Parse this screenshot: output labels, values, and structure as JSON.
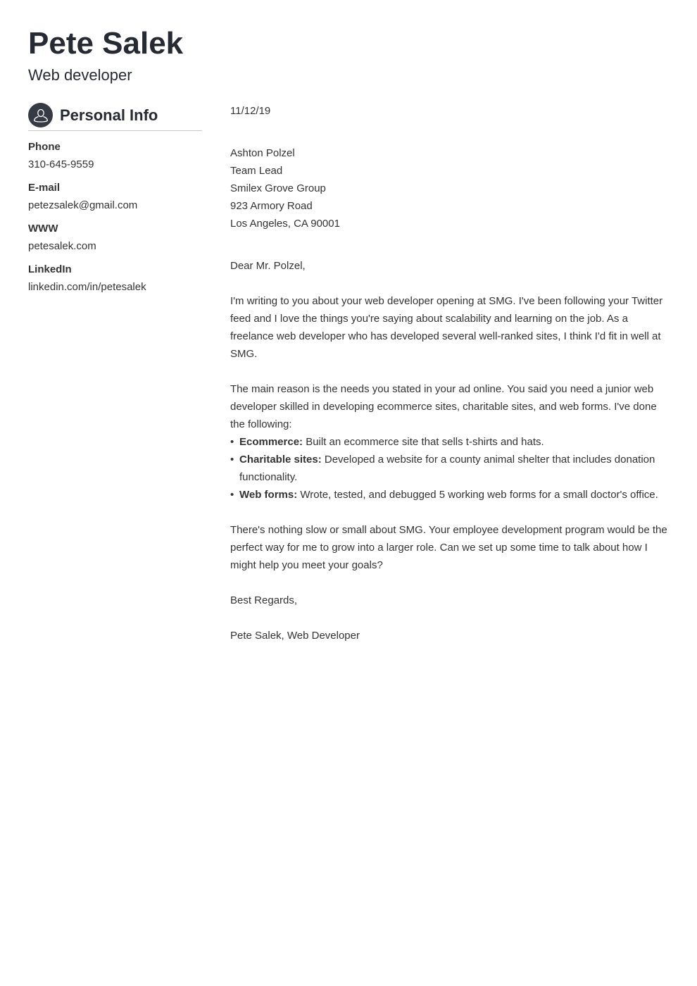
{
  "header": {
    "name": "Pete Salek",
    "title": "Web developer"
  },
  "sidebar": {
    "section_icon": "user-icon",
    "section_title": "Personal Info",
    "items": [
      {
        "label": "Phone",
        "value": "310-645-9559"
      },
      {
        "label": "E-mail",
        "value": "petezsalek@gmail.com"
      },
      {
        "label": "WWW",
        "value": "petesalek.com"
      },
      {
        "label": "LinkedIn",
        "value": "linkedin.com/in/petesalek"
      }
    ]
  },
  "letter": {
    "date": "11/12/19",
    "recipient": [
      "Ashton Polzel",
      "Team Lead",
      "Smilex Grove Group",
      "923 Armory Road",
      "Los Angeles, CA 90001"
    ],
    "salutation": "Dear Mr. Polzel,",
    "paragraph1": "I'm writing to you about your web developer opening at SMG. I've been following your Twitter feed and I love the things you're saying about scalability and learning on the job. As a freelance web developer who has developed several well-ranked sites, I think I'd fit in well at SMG.",
    "paragraph2": "The main reason is the needs you stated in your ad online. You said you need a junior web developer skilled in developing ecommerce sites, charitable sites, and web forms. I've done the following:",
    "bullets": [
      {
        "title": "Ecommerce:",
        "text": " Built an ecommerce site that sells t-shirts and hats."
      },
      {
        "title": "Charitable sites:",
        "text": " Developed a website for a county animal shelter that includes donation functionality."
      },
      {
        "title": "Web forms:",
        "text": " Wrote, tested, and debugged 5 working web forms for a small doctor's office."
      }
    ],
    "paragraph3": "There's nothing slow or small about SMG. Your employee development program would be the perfect way for me to grow into a larger role. Can we set up some time to talk about how I might help you meet your goals?",
    "closing": "Best Regards,",
    "signature": "Pete Salek, Web Developer"
  }
}
